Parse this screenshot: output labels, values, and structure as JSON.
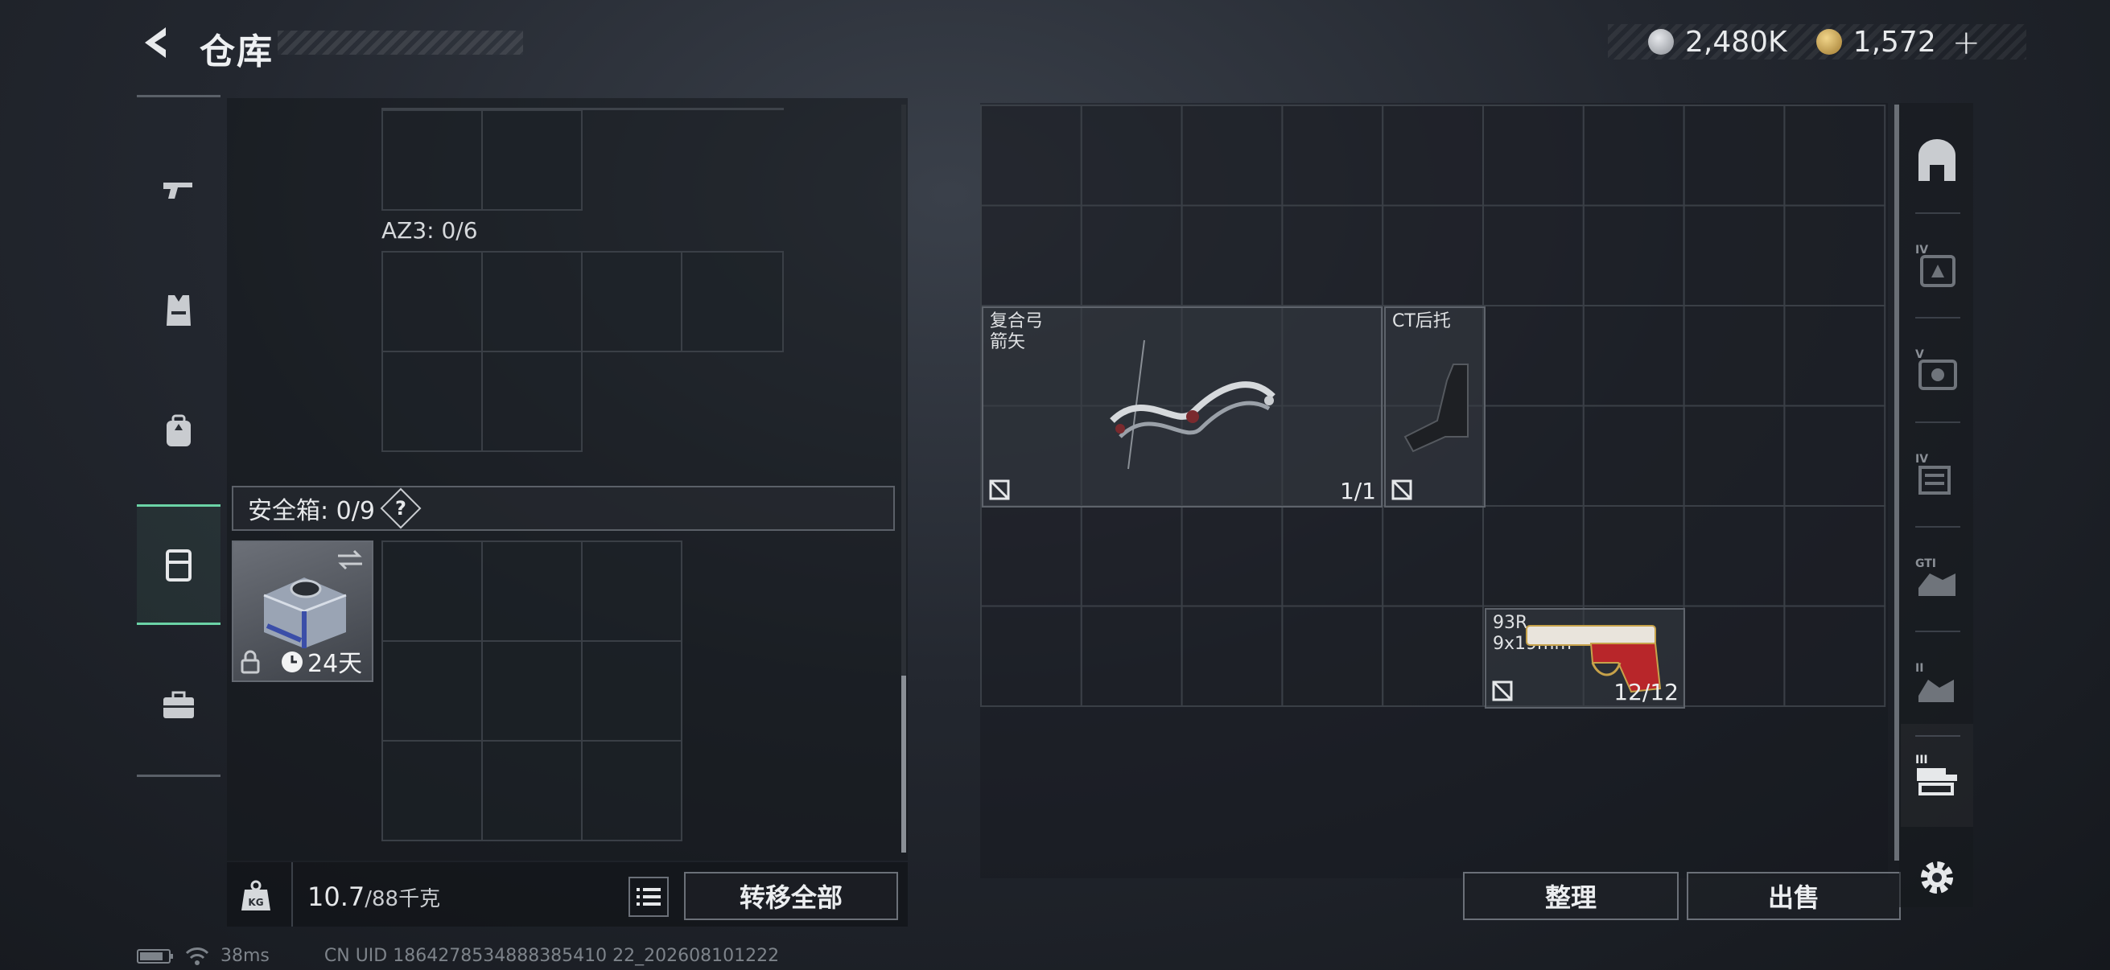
{
  "header": {
    "title": "仓库",
    "currency_silver": "2,480K",
    "currency_gold": "1,572"
  },
  "left": {
    "az3_label": "AZ3: 0/6",
    "safebox_label": "安全箱: 0/9",
    "safebox_help": "?",
    "safebox_days": "24天",
    "weight_value": "10.7",
    "weight_max": "/88千克",
    "transfer_all": "转移全部"
  },
  "right": {
    "items": [
      {
        "name_line1": "复合弓",
        "name_line2": "箭矢",
        "count": "1/1"
      },
      {
        "name_line1": "CT后托",
        "name_line2": "",
        "count": ""
      },
      {
        "name_line1": "93R",
        "name_line2": "9x19mm",
        "count": "12/12"
      }
    ],
    "sort_button": "整理",
    "sell_button": "出售"
  },
  "side_tabs": [
    {
      "icon": "home-icon",
      "label": ""
    },
    {
      "icon": "gear-level-icon",
      "label": "IV"
    },
    {
      "icon": "gear-level-icon",
      "label": "V"
    },
    {
      "icon": "gear-level-icon",
      "label": "IV"
    },
    {
      "icon": "gear-level-icon",
      "label": "GTI"
    },
    {
      "icon": "gear-level-icon",
      "label": "II"
    },
    {
      "icon": "gear-level-icon",
      "label": "III"
    }
  ],
  "status": {
    "ping": "38ms",
    "uid": "CN UID 1864278534888385410 22_202608101222"
  },
  "colors": {
    "accent_green": "#6bd3a6",
    "pistol_red": "#b8262a"
  }
}
